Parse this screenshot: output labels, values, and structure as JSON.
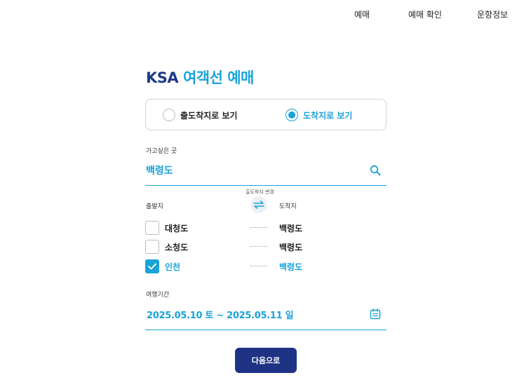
{
  "nav": {
    "items": [
      "예매",
      "예매 확인",
      "운항정보"
    ]
  },
  "page": {
    "title_brand": "KSA",
    "title_rest": "여객선 예매"
  },
  "view_toggle": {
    "options": [
      {
        "label": "출도착지로 보기",
        "selected": false
      },
      {
        "label": "도착지로 보기",
        "selected": true
      }
    ]
  },
  "destination": {
    "label": "가고싶은 곳",
    "value": "백령도"
  },
  "routes": {
    "swap_label": "출도착지 변경",
    "departure_header": "출발지",
    "arrival_header": "도착지",
    "rows": [
      {
        "departure": "대청도",
        "arrival": "백령도",
        "checked": false
      },
      {
        "departure": "소청도",
        "arrival": "백령도",
        "checked": false
      },
      {
        "departure": "인천",
        "arrival": "백령도",
        "checked": true
      }
    ]
  },
  "period": {
    "label": "여행기간",
    "value": "2025.05.10 토 ~ 2025.05.11 일"
  },
  "actions": {
    "next_label": "다음으로"
  },
  "colors": {
    "accent": "#1aa3d9",
    "brand": "#1f3a8a",
    "button": "#1e3384",
    "border": "#cfd4da"
  },
  "icons": [
    "search-icon",
    "swap-icon",
    "check-icon",
    "calendar-icon"
  ]
}
